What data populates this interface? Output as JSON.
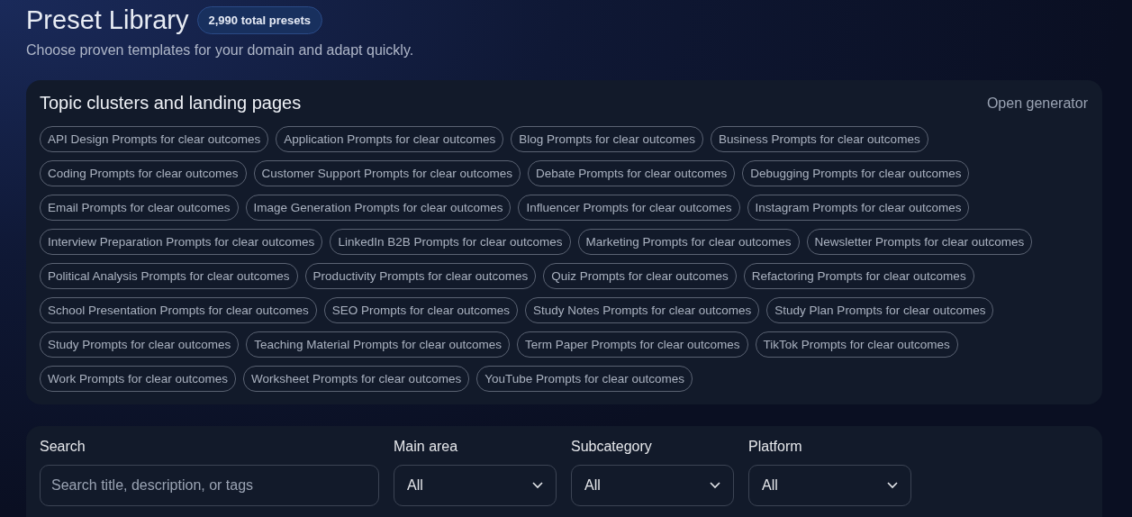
{
  "header": {
    "title": "Preset Library",
    "count_badge": "2,990 total presets",
    "subtitle": "Choose proven templates for your domain and adapt quickly."
  },
  "topics": {
    "title": "Topic clusters and landing pages",
    "action": "Open generator",
    "chips": [
      "API Design Prompts for clear outcomes",
      "Application Prompts for clear outcomes",
      "Blog Prompts for clear outcomes",
      "Business Prompts for clear outcomes",
      "Coding Prompts for clear outcomes",
      "Customer Support Prompts for clear outcomes",
      "Debate Prompts for clear outcomes",
      "Debugging Prompts for clear outcomes",
      "Email Prompts for clear outcomes",
      "Image Generation Prompts for clear outcomes",
      "Influencer Prompts for clear outcomes",
      "Instagram Prompts for clear outcomes",
      "Interview Preparation Prompts for clear outcomes",
      "LinkedIn B2B Prompts for clear outcomes",
      "Marketing Prompts for clear outcomes",
      "Newsletter Prompts for clear outcomes",
      "Political Analysis Prompts for clear outcomes",
      "Productivity Prompts for clear outcomes",
      "Quiz Prompts for clear outcomes",
      "Refactoring Prompts for clear outcomes",
      "School Presentation Prompts for clear outcomes",
      "SEO Prompts for clear outcomes",
      "Study Notes Prompts for clear outcomes",
      "Study Plan Prompts for clear outcomes",
      "Study Prompts for clear outcomes",
      "Teaching Material Prompts for clear outcomes",
      "Term Paper Prompts for clear outcomes",
      "TikTok Prompts for clear outcomes",
      "Work Prompts for clear outcomes",
      "Worksheet Prompts for clear outcomes",
      "YouTube Prompts for clear outcomes"
    ]
  },
  "filters": {
    "search": {
      "label": "Search",
      "placeholder": "Search title, description, or tags"
    },
    "selects": [
      {
        "label": "Main area",
        "value": "All"
      },
      {
        "label": "Subcategory",
        "value": "All"
      },
      {
        "label": "Platform",
        "value": "All"
      }
    ]
  }
}
